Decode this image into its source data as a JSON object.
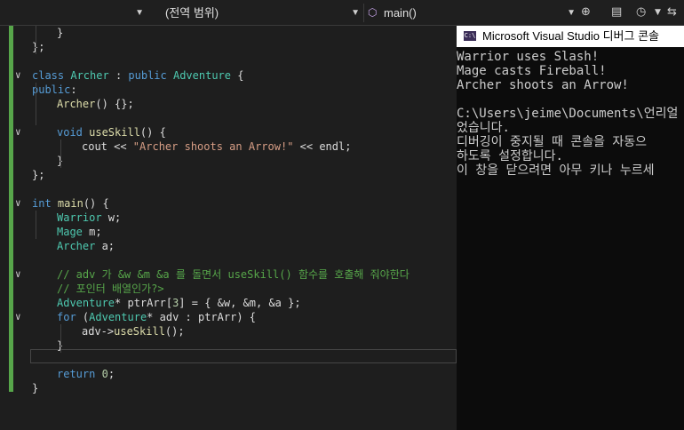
{
  "toolbar": {
    "scope_combo": "(전역 범위)",
    "member_combo": "main()",
    "icon_split": "split-icon",
    "icon_doc": "document-icon",
    "icon_history": "history-icon",
    "icon_swap": "swap-icon"
  },
  "code": {
    "lines": [
      {
        "segs": [
          [
            "pl",
            "}"
          ]
        ]
      },
      {
        "segs": [
          [
            "pl",
            "};"
          ]
        ]
      },
      {
        "segs": []
      },
      {
        "segs": [
          [
            "kw",
            "class "
          ],
          [
            "ty",
            "Archer"
          ],
          [
            "pl",
            " : "
          ],
          [
            "kw",
            "public "
          ],
          [
            "ty",
            "Adventure"
          ],
          [
            "pl",
            " {"
          ]
        ]
      },
      {
        "segs": [
          [
            "kw",
            "public"
          ],
          [
            "pl",
            ":"
          ]
        ]
      },
      {
        "segs": [
          [
            "fn",
            "Archer"
          ],
          [
            "pl",
            "() {};"
          ]
        ]
      },
      {
        "segs": []
      },
      {
        "segs": [
          [
            "kw",
            "void "
          ],
          [
            "fn",
            "useSkill"
          ],
          [
            "pl",
            "() {"
          ]
        ]
      },
      {
        "segs": [
          [
            "pl",
            "cout << "
          ],
          [
            "str",
            "\"Archer shoots an Arrow!\""
          ],
          [
            "pl",
            " << endl;"
          ]
        ]
      },
      {
        "segs": [
          [
            "pl",
            "}"
          ]
        ]
      },
      {
        "segs": [
          [
            "pl",
            "};"
          ]
        ]
      },
      {
        "segs": []
      },
      {
        "segs": [
          [
            "kw",
            "int "
          ],
          [
            "fn",
            "main"
          ],
          [
            "pl",
            "() {"
          ]
        ]
      },
      {
        "segs": [
          [
            "ty",
            "Warrior"
          ],
          [
            "pl",
            " w;"
          ]
        ]
      },
      {
        "segs": [
          [
            "ty",
            "Mage"
          ],
          [
            "pl",
            " m;"
          ]
        ]
      },
      {
        "segs": [
          [
            "ty",
            "Archer"
          ],
          [
            "pl",
            " a;"
          ]
        ]
      },
      {
        "segs": []
      },
      {
        "segs": [
          [
            "cm",
            "// adv 가 &w &m &a 를 돌면서 useSkill() 함수를 호출해 줘야한다"
          ]
        ]
      },
      {
        "segs": [
          [
            "cm",
            "// 포인터 배열인가?>"
          ]
        ]
      },
      {
        "segs": [
          [
            "ty",
            "Adventure"
          ],
          [
            "pl",
            "* ptrArr["
          ],
          [
            "num",
            "3"
          ],
          [
            "pl",
            "] = { &w, &m, &a };"
          ]
        ]
      },
      {
        "segs": [
          [
            "kw",
            "for "
          ],
          [
            "pl",
            "("
          ],
          [
            "ty",
            "Adventure"
          ],
          [
            "pl",
            "* adv : ptrArr) {"
          ]
        ]
      },
      {
        "segs": [
          [
            "pl",
            "adv->"
          ],
          [
            "fn",
            "useSkill"
          ],
          [
            "pl",
            "();"
          ]
        ]
      },
      {
        "segs": [
          [
            "pl",
            "}"
          ]
        ]
      },
      {
        "segs": []
      },
      {
        "segs": [
          [
            "kw",
            "return "
          ],
          [
            "num",
            "0"
          ],
          [
            "pl",
            ";"
          ]
        ]
      },
      {
        "segs": [
          [
            "pl",
            "}"
          ]
        ]
      }
    ]
  },
  "console": {
    "title": "Microsoft Visual Studio 디버그 콘솔",
    "icon_label": "C:\\",
    "lines": [
      "Warrior uses Slash!",
      "Mage casts Fireball!",
      "Archer shoots an Arrow!",
      "",
      "C:\\Users\\jeime\\Documents\\언리얼",
      "었습니다.",
      "디버깅이 중지될 때 콘솔을 자동으",
      "하도록 설정합니다.",
      "이 창을 닫으려면 아무 키나 누르세"
    ]
  }
}
